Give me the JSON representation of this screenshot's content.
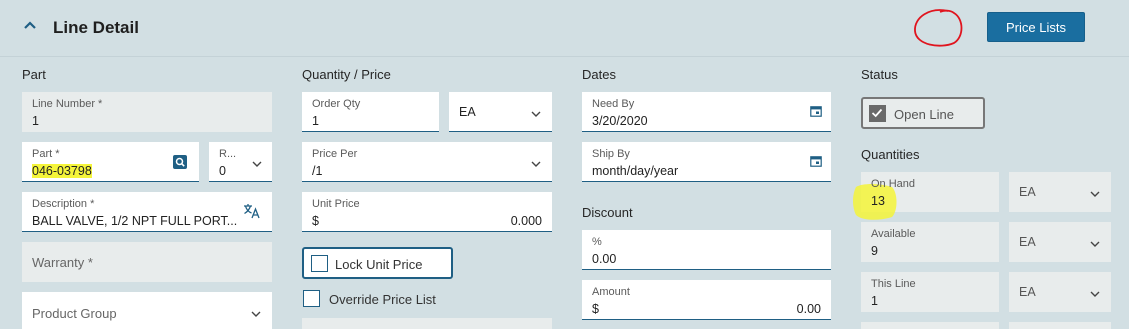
{
  "header": {
    "title": "Line Detail",
    "price_lists_button": "Price Lists"
  },
  "sections": {
    "part": "Part",
    "quantity_price": "Quantity / Price",
    "dates": "Dates",
    "status": "Status",
    "discount": "Discount",
    "quantities": "Quantities"
  },
  "part": {
    "line_number_label": "Line Number *",
    "line_number_value": "1",
    "part_label": "Part *",
    "part_value": "046-03798",
    "revision_label": "R...",
    "revision_value": "0",
    "description_label": "Description *",
    "description_value": "BALL VALVE, 1/2 NPT FULL PORT...",
    "warranty_placeholder": "Warranty *",
    "product_group_placeholder": "Product Group"
  },
  "quantity_price": {
    "order_qty_label": "Order Qty",
    "order_qty_value": "1",
    "uom_value": "EA",
    "price_per_label": "Price Per",
    "price_per_value": "/1",
    "unit_price_label": "Unit Price",
    "unit_price_currency": "$",
    "unit_price_value": "0.000",
    "lock_unit_price_label": "Lock Unit Price",
    "override_price_list_label": "Override Price List"
  },
  "dates": {
    "need_by_label": "Need By",
    "need_by_value": "3/20/2020",
    "ship_by_label": "Ship By",
    "ship_by_value": "month/day/year"
  },
  "discount": {
    "percent_label": "%",
    "percent_value": "0.00",
    "amount_label": "Amount",
    "amount_currency": "$",
    "amount_value": "0.00"
  },
  "status": {
    "open_line_label": "Open Line",
    "open_line_checked": true
  },
  "quantities": {
    "on_hand_label": "On Hand",
    "on_hand_value": "13",
    "on_hand_uom": "EA",
    "available_label": "Available",
    "available_value": "9",
    "available_uom": "EA",
    "this_line_label": "This Line",
    "this_line_value": "1",
    "this_line_uom": "EA"
  },
  "colors": {
    "panel_bg": "#d2dfe3",
    "accent": "#1a6ea0",
    "highlight": "#f5f53a",
    "annotation_red": "#e0141e"
  },
  "icons": [
    "chevron-up-icon",
    "search-icon",
    "translate-icon",
    "calendar-icon",
    "chevron-down-icon",
    "checkmark-icon"
  ]
}
